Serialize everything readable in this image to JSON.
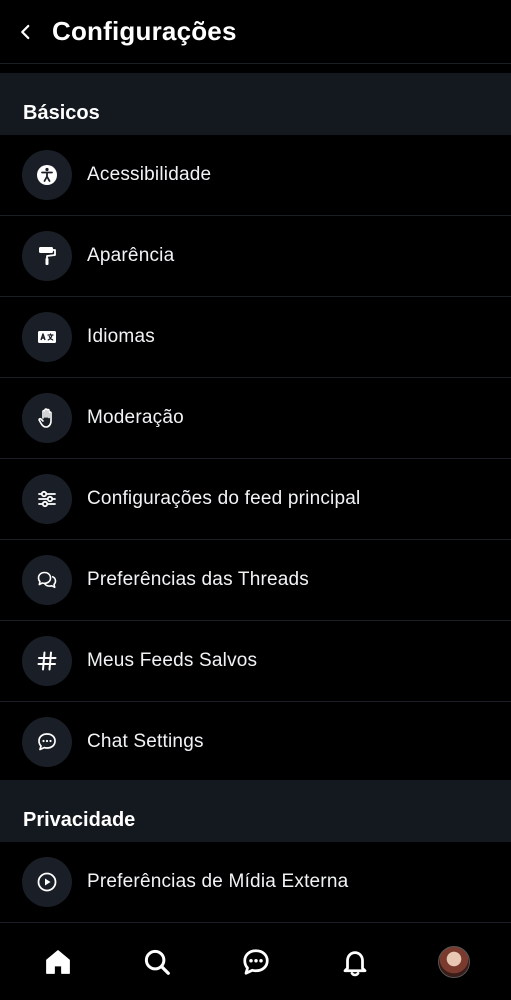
{
  "header": {
    "title": "Configurações"
  },
  "sections": {
    "basics": {
      "title": "Básicos",
      "items": [
        {
          "label": "Acessibilidade",
          "icon": "accessibility-icon"
        },
        {
          "label": "Aparência",
          "icon": "paint-roller-icon"
        },
        {
          "label": "Idiomas",
          "icon": "language-icon"
        },
        {
          "label": "Moderação",
          "icon": "hand-icon"
        },
        {
          "label": "Configurações do feed principal",
          "icon": "sliders-icon"
        },
        {
          "label": "Preferências das Threads",
          "icon": "chat-bubbles-icon"
        },
        {
          "label": "Meus Feeds Salvos",
          "icon": "hashtag-icon"
        },
        {
          "label": "Chat Settings",
          "icon": "message-icon"
        }
      ]
    },
    "privacy": {
      "title": "Privacidade",
      "items": [
        {
          "label": "Preferências de Mídia Externa",
          "icon": "play-circle-icon"
        }
      ]
    }
  },
  "bottom_nav": {
    "items": [
      "home-icon",
      "search-icon",
      "chat-icon",
      "bell-icon",
      "avatar"
    ]
  },
  "colors": {
    "background": "#000000",
    "section_bg": "#14181f",
    "icon_circle_bg": "#1a1e26",
    "divider": "#1b1f25"
  }
}
